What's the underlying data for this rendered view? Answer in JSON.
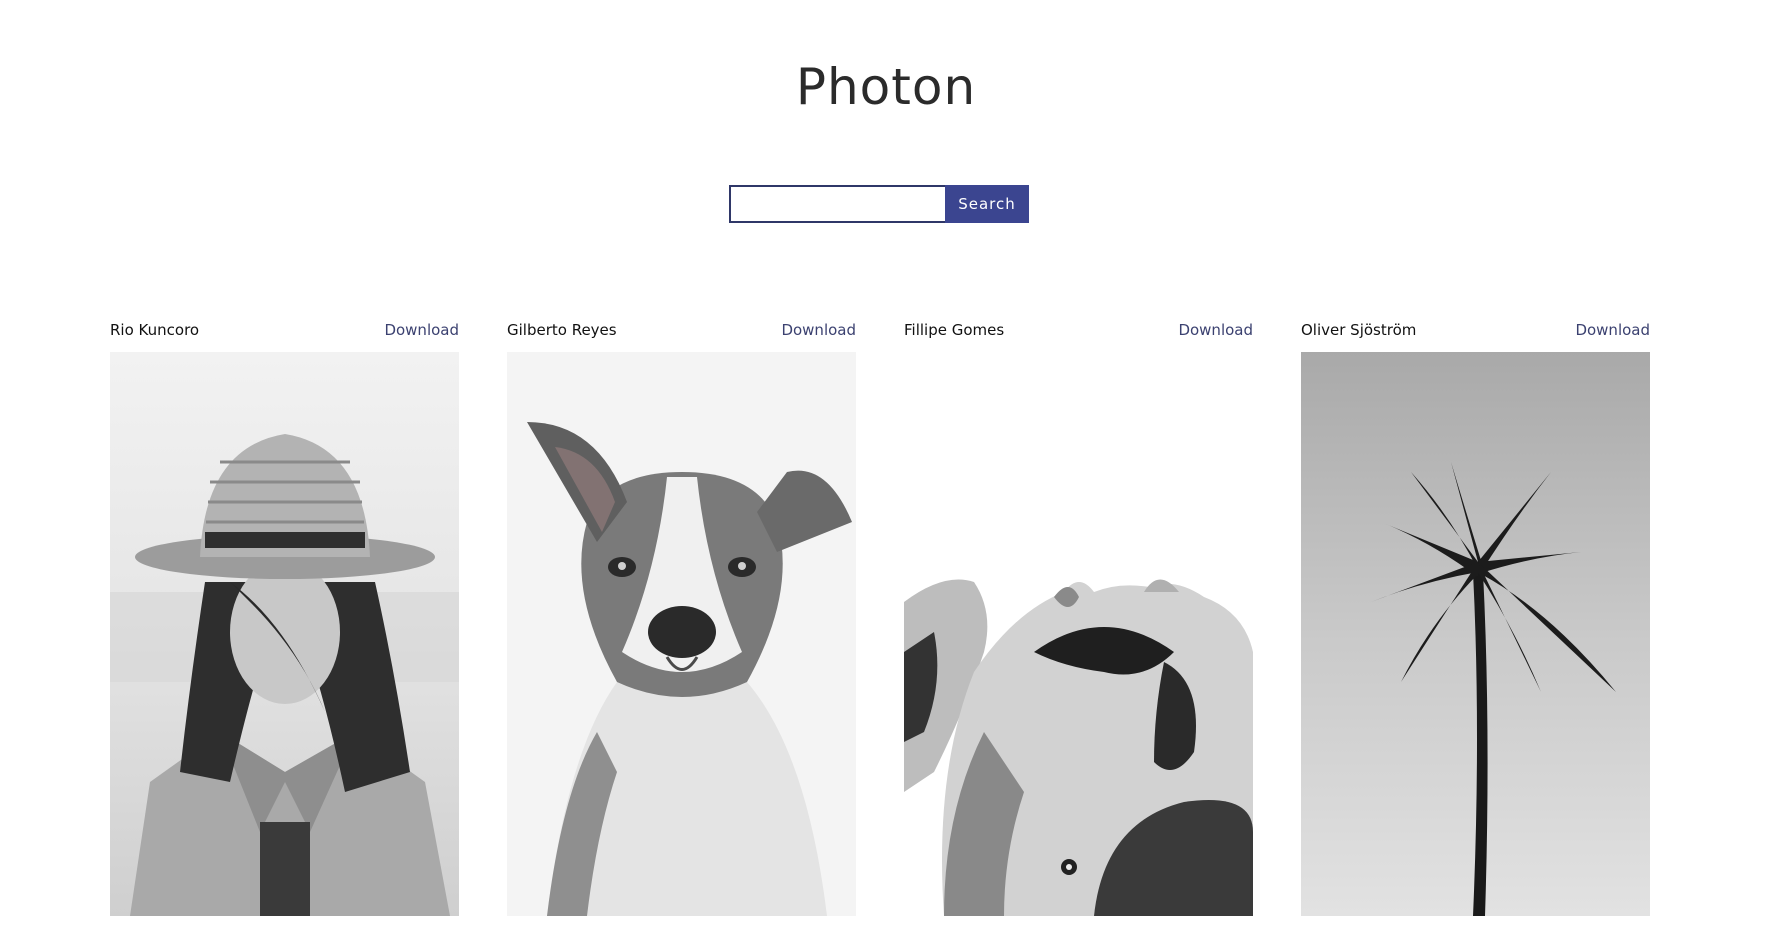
{
  "header": {
    "title": "Photon"
  },
  "search": {
    "placeholder": "",
    "value": "",
    "button_label": "Search"
  },
  "photos": [
    {
      "author": "Rio Kuncoro",
      "download_label": "Download",
      "subject": "woman-in-hat"
    },
    {
      "author": "Gilberto Reyes",
      "download_label": "Download",
      "subject": "dog-portrait"
    },
    {
      "author": "Fillipe Gomes",
      "download_label": "Download",
      "subject": "face-with-petals"
    },
    {
      "author": "Oliver Sjöström",
      "download_label": "Download",
      "subject": "palm-tree"
    }
  ],
  "colors": {
    "accent": "#3b4590",
    "link": "#3b4170",
    "title": "#2b2b2b"
  }
}
